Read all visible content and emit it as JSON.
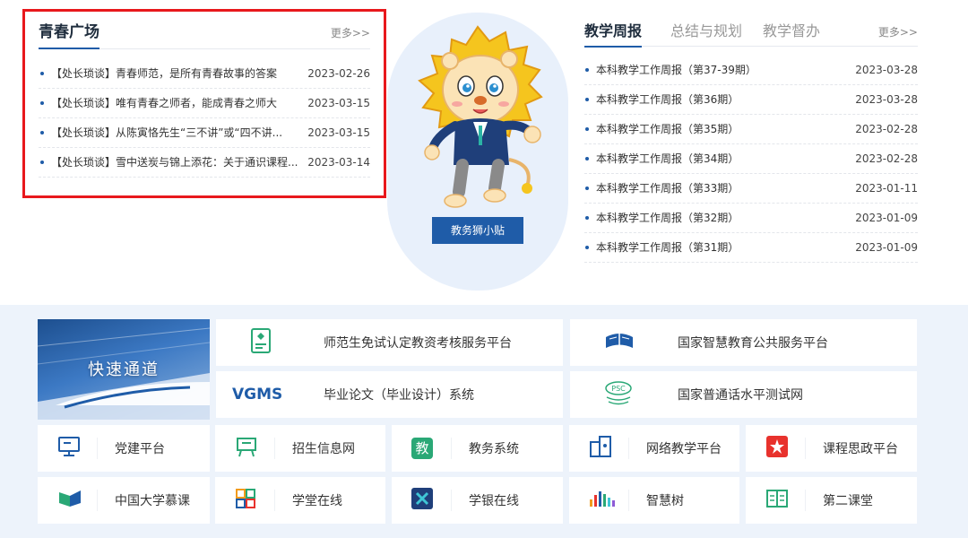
{
  "youth_square": {
    "title": "青春广场",
    "more": "更多>>",
    "items": [
      {
        "title": "【处长琐谈】青春师范，是所有青春故事的答案",
        "date": "2023-02-26"
      },
      {
        "title": "【处长琐谈】唯有青春之师者，能成青春之师大",
        "date": "2023-03-15"
      },
      {
        "title": "【处长琐谈】从陈寅恪先生“三不讲”或“四不讲...",
        "date": "2023-03-15"
      },
      {
        "title": "【处长琐谈】雪中送炭与锦上添花：关于通识课程...",
        "date": "2023-03-14"
      }
    ]
  },
  "mascot": {
    "button": "教务狮小贴"
  },
  "weekly": {
    "tabs": [
      "教学周报",
      "总结与规划",
      "教学督办"
    ],
    "active_tab": 0,
    "more": "更多>>",
    "items": [
      {
        "title": "本科教学工作周报（第37-39期）",
        "date": "2023-03-28"
      },
      {
        "title": "本科教学工作周报（第36期）",
        "date": "2023-03-28"
      },
      {
        "title": "本科教学工作周报（第35期）",
        "date": "2023-02-28"
      },
      {
        "title": "本科教学工作周报（第34期）",
        "date": "2023-02-28"
      },
      {
        "title": "本科教学工作周报（第33期）",
        "date": "2023-01-11"
      },
      {
        "title": "本科教学工作周报（第32期）",
        "date": "2023-01-09"
      },
      {
        "title": "本科教学工作周报（第31期）",
        "date": "2023-01-09"
      }
    ]
  },
  "quick": {
    "banner": "快速通道",
    "wide_links": [
      {
        "label": "师范生免试认定教资考核服务平台",
        "icon": "certificate-icon"
      },
      {
        "label": "国家智慧教育公共服务平台",
        "icon": "open-book-icon"
      },
      {
        "label": "毕业论文（毕业设计）系统",
        "icon": "vgms-logo",
        "logo_text": "VGMS"
      },
      {
        "label": "国家普通话水平测试网",
        "icon": "psc-logo",
        "logo_text": "PSC"
      }
    ],
    "small_links": [
      {
        "label": "党建平台",
        "icon": "monitor-icon"
      },
      {
        "label": "招生信息网",
        "icon": "easel-icon"
      },
      {
        "label": "教务系统",
        "icon": "jiao-icon",
        "glyph": "教"
      },
      {
        "label": "网络教学平台",
        "icon": "network-icon"
      },
      {
        "label": "课程思政平台",
        "icon": "star-badge-icon"
      },
      {
        "label": "中国大学慕课",
        "icon": "mooc-icon"
      },
      {
        "label": "学堂在线",
        "icon": "grid-icon"
      },
      {
        "label": "学银在线",
        "icon": "x-icon"
      },
      {
        "label": "智慧树",
        "icon": "bars-icon"
      },
      {
        "label": "第二课堂",
        "icon": "book-icon"
      }
    ]
  },
  "colors": {
    "accent": "#1f5ca8",
    "highlight_border": "#e8181c",
    "quick_bg": "#edf3fb"
  }
}
